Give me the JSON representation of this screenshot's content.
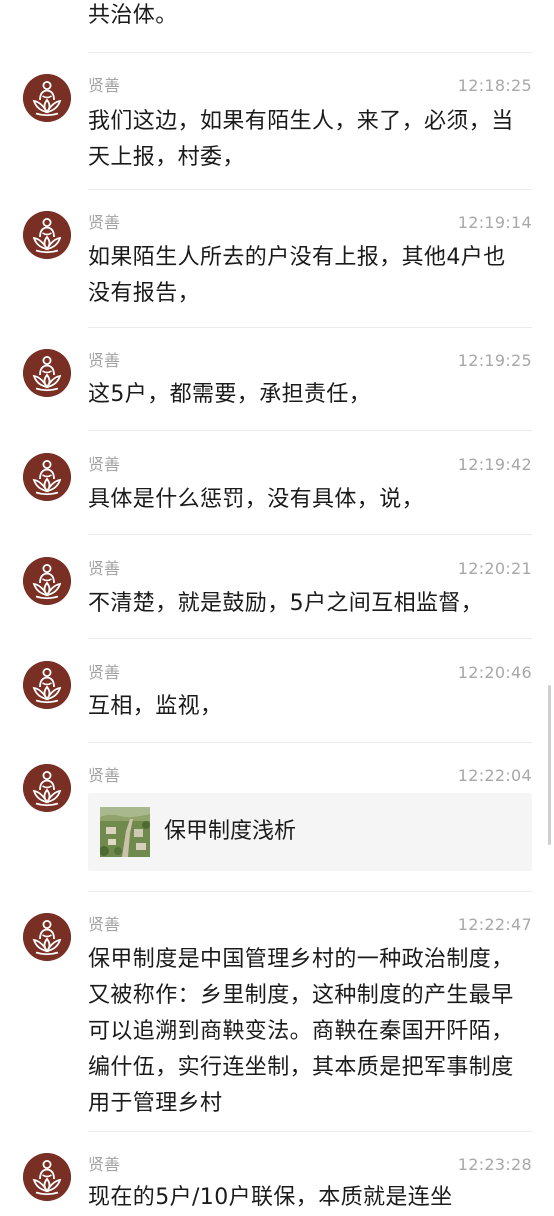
{
  "chat": {
    "messages": [
      {
        "sender": "",
        "time": "",
        "text": "共治体。"
      },
      {
        "sender": "贤善",
        "time": "12:18:25",
        "text": "我们这边，如果有陌生人，来了，必须，当天上报，村委，"
      },
      {
        "sender": "贤善",
        "time": "12:19:14",
        "text": "如果陌生人所去的户没有上报，其他4户也没有报告，"
      },
      {
        "sender": "贤善",
        "time": "12:19:25",
        "text": "这5户，都需要，承担责任，"
      },
      {
        "sender": "贤善",
        "time": "12:19:42",
        "text": "具体是什么惩罚，没有具体，说，"
      },
      {
        "sender": "贤善",
        "time": "12:20:21",
        "text": "不清楚，就是鼓励，5户之间互相监督，"
      },
      {
        "sender": "贤善",
        "time": "12:20:46",
        "text": "互相，监视，"
      },
      {
        "sender": "贤善",
        "time": "12:22:04",
        "link_title": "保甲制度浅析",
        "thumbnail_icon": "village-aerial-photo"
      },
      {
        "sender": "贤善",
        "time": "12:22:47",
        "text": "保甲制度是中国管理乡村的一种政治制度，又被称作：乡里制度，这种制度的产生最早可以追溯到商鞅变法。商鞅在秦国开阡陌，编什伍，实行连坐制，其本质是把军事制度用于管理乡村"
      },
      {
        "sender": "贤善",
        "time": "12:23:28",
        "text": "现在的5户/10户联保，本质就是连坐"
      }
    ]
  },
  "colors": {
    "avatar_bg": "#7a2f24",
    "avatar_fg": "#ffffff",
    "meta_text": "#a8a8a8",
    "card_bg": "#f5f5f5"
  },
  "icons": {
    "avatar": "lotus-buddha-logo-icon"
  }
}
